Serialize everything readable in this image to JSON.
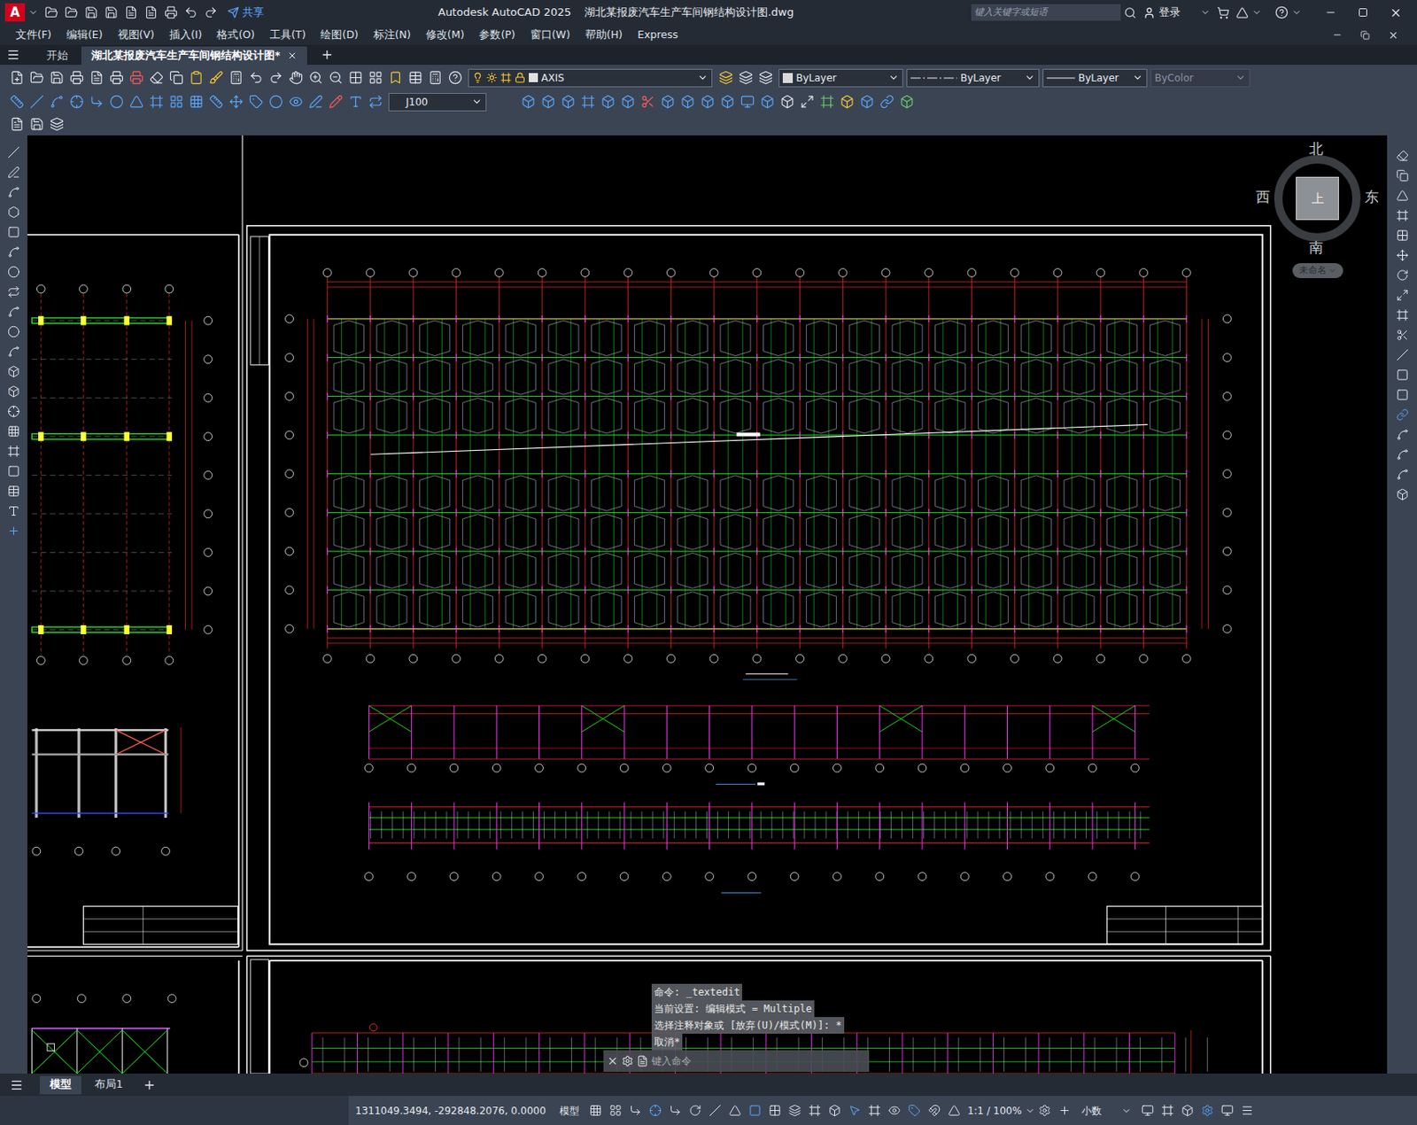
{
  "window": {
    "logo": "A",
    "app": "Autodesk AutoCAD 2025",
    "file": "湖北某报废汽车生产车间钢结构设计图.dwg"
  },
  "quick_access": {
    "share": "共享"
  },
  "search": {
    "placeholder": "键入关键字或短语"
  },
  "account": {
    "login": "登录"
  },
  "menu": [
    "文件(F)",
    "编辑(E)",
    "视图(V)",
    "插入(I)",
    "格式(O)",
    "工具(T)",
    "绘图(D)",
    "标注(N)",
    "修改(M)",
    "参数(P)",
    "窗口(W)",
    "帮助(H)",
    "Express"
  ],
  "doc_tabs": [
    {
      "label": "开始",
      "selected": false
    },
    {
      "label": "湖北某报废汽车生产车间钢结构设计图*",
      "selected": true
    }
  ],
  "properties": {
    "layer": "AXIS",
    "color": "ByLayer",
    "linetype": "ByLayer",
    "lineweight": "ByLayer",
    "plot_style": {
      "label": "ByColor",
      "disabled": true
    },
    "dim_style": "J100"
  },
  "viewcube": {
    "north": "北",
    "south": "南",
    "east": "东",
    "west": "西",
    "face": "上",
    "ucs": "未命名"
  },
  "command_history": [
    "命令: _textedit",
    "当前设置: 编辑模式 = Multiple",
    "选择注释对象或 [放弃(U)/模式(M)]: *",
    "取消*"
  ],
  "command_input": {
    "placeholder": "键入命令"
  },
  "layout_tabs": [
    {
      "label": "模型",
      "selected": true
    },
    {
      "label": "布局1",
      "selected": false
    }
  ],
  "status_bar": {
    "coords": "1311049.3494, -292848.2076, 0.0000",
    "space": "模型",
    "scale": "1:1 / 100%",
    "units": "小数"
  },
  "drawing": {
    "plan_bays": 20,
    "plan_rows": 8,
    "elevation_bays": 18,
    "braced_bays": [
      0,
      5,
      12,
      17
    ]
  }
}
